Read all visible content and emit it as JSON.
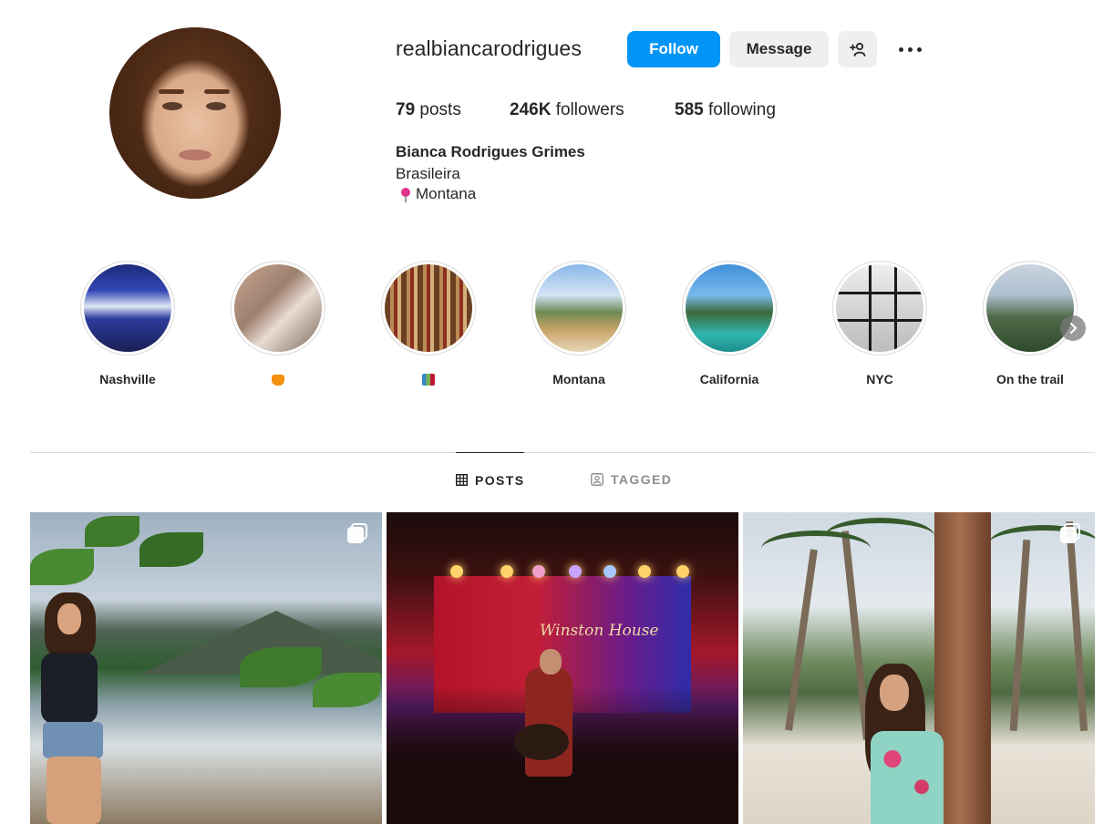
{
  "profile": {
    "username": "realbiancarodrigues",
    "full_name": "Bianca Rodrigues Grimes",
    "bio_line1": "Brasileira",
    "bio_line2": "Montana",
    "actions": {
      "follow_label": "Follow",
      "message_label": "Message",
      "suggest_icon": "add-person-icon",
      "more_icon": "more-options-icon"
    },
    "stats": {
      "posts_count": "79",
      "posts_label": "posts",
      "followers_count": "246K",
      "followers_label": "followers",
      "following_count": "585",
      "following_label": "following"
    }
  },
  "highlights": [
    {
      "label": "Nashville"
    },
    {
      "label": "",
      "emoji": "cat-emoji"
    },
    {
      "label": "",
      "emoji": "books-emoji"
    },
    {
      "label": "Montana"
    },
    {
      "label": "California"
    },
    {
      "label": "NYC"
    },
    {
      "label": "On the trail"
    }
  ],
  "tabs": {
    "posts_label": "POSTS",
    "tagged_label": "TAGGED",
    "active": "POSTS"
  },
  "posts": [
    {
      "id_label": "post-beach-mountains",
      "multi": true
    },
    {
      "id_label": "post-concert",
      "multi": false,
      "sign_text": "Winston House"
    },
    {
      "id_label": "post-palm-trees",
      "multi": true
    }
  ],
  "colors": {
    "follow_button": "#0095f6",
    "secondary_button": "#efefef",
    "text": "#262626",
    "muted": "#8e8e8e",
    "divider": "#dbdbdb"
  }
}
